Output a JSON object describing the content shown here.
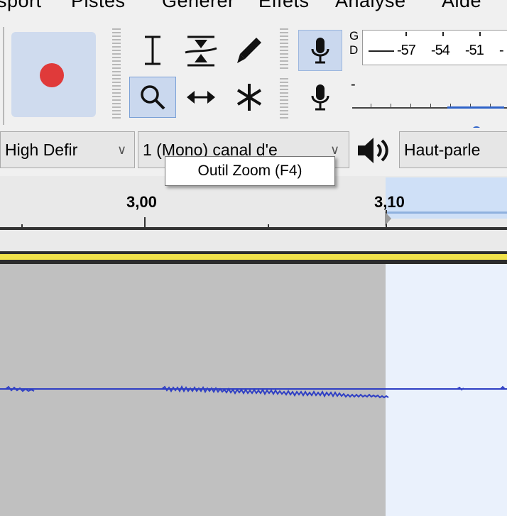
{
  "menu": {
    "items": [
      "sport",
      "Pistes",
      "Générer",
      "Effets",
      "Analyse",
      "Aide"
    ]
  },
  "meter": {
    "g_label": "G",
    "d_label": "D",
    "scale": [
      "-57",
      "-54",
      "-51",
      "-"
    ],
    "playback_minus": "-"
  },
  "devices": {
    "input_device": "High Defir",
    "channels": "1 (Mono) canal d'e",
    "output_device": "Haut-parle"
  },
  "tooltip": {
    "text": "Outil Zoom (F4)"
  },
  "ruler": {
    "labels": [
      "3,00",
      "3,10"
    ]
  },
  "colors": {
    "record_red": "#e03a3a",
    "selection_blue": "#cfe0f7",
    "waveform_blue": "#2f3fc4",
    "track_yellow": "#f1e24a"
  },
  "icons": {
    "selection_tool": "i-beam-icon",
    "envelope_tool": "envelope-icon",
    "draw_tool": "pencil-icon",
    "zoom_tool": "magnifier-icon",
    "timeshift_tool": "double-arrow-icon",
    "multi_tool": "asterisk-icon",
    "record_meter": "microphone-icon",
    "speaker": "speaker-icon"
  }
}
